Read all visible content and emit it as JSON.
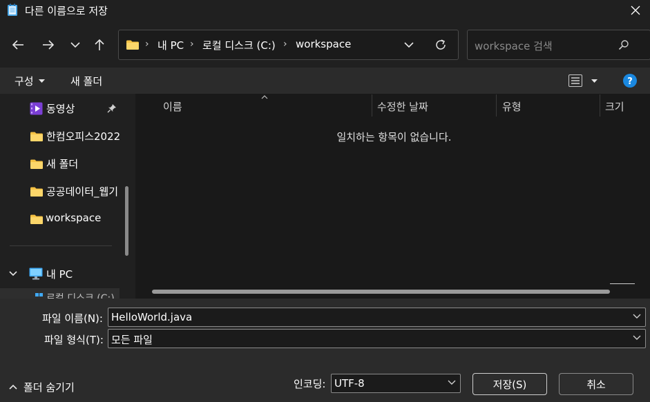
{
  "window": {
    "title": "다른 이름으로 저장",
    "title_icon": "notepad-icon",
    "close_icon": "close-icon"
  },
  "nav": {
    "back_icon": "back-arrow-icon",
    "forward_icon": "forward-arrow-icon",
    "recent_icon": "chevron-down-icon",
    "up_icon": "up-arrow-icon",
    "breadcrumbs": [
      "내 PC",
      "로컬 디스크 (C:)",
      "workspace"
    ],
    "refresh_icon": "refresh-icon",
    "search_placeholder": "workspace 검색"
  },
  "toolbar": {
    "organize_label": "구성",
    "new_folder_label": "새 폴더",
    "view_icon": "view-list-icon",
    "help_icon": "help-icon"
  },
  "sidebar": {
    "items": [
      {
        "label": "동영상",
        "icon": "videos-icon",
        "pinned": true
      },
      {
        "label": "한컴오피스2022",
        "icon": "folder-icon"
      },
      {
        "label": "새 폴더",
        "icon": "folder-icon"
      },
      {
        "label": "공공데이터_웹기",
        "icon": "folder-icon"
      },
      {
        "label": "workspace",
        "icon": "folder-icon"
      }
    ],
    "this_pc_label": "내 PC",
    "partial_label": "로컬 디스크 (C:)"
  },
  "file_list": {
    "columns": [
      "이름",
      "수정한 날짜",
      "유형",
      "크기"
    ],
    "empty_message": "일치하는 항목이 없습니다."
  },
  "form": {
    "filename_label": "파일 이름(N):",
    "filename_value": "HelloWorld.java",
    "filetype_label": "파일 형식(T):",
    "filetype_value": "모든 파일",
    "encoding_label": "인코딩:",
    "encoding_value": "UTF-8",
    "hide_folders_label": "폴더 숨기기",
    "save_label": "저장(S)",
    "cancel_label": "취소"
  },
  "colors": {
    "folder_yellow": "#f6c244",
    "help_blue": "#1a88e0",
    "pc_blue": "#3fa9f5"
  }
}
